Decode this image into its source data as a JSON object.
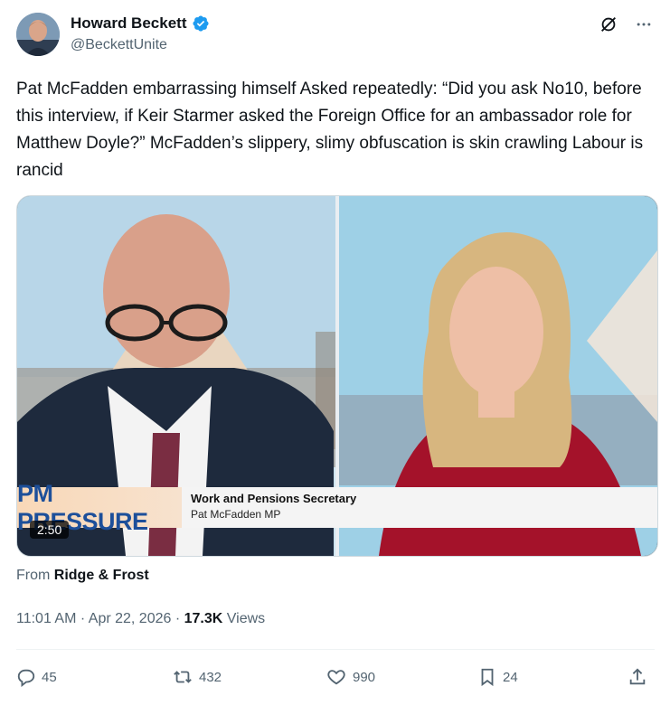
{
  "author": {
    "name": "Howard Beckett",
    "handle": "@BeckettUnite"
  },
  "tweet": {
    "text": "Pat McFadden embarrassing himself Asked repeatedly: “Did you ask No10, before this interview, if Keir Starmer asked the Foreign Office for an ambassador role for Matthew Doyle?” McFadden’s slippery, slimy obfuscation is skin crawling Labour is rancid"
  },
  "video": {
    "lower_third_title": "PM PRESSURE",
    "lower_third_line1": "Work and Pensions Secretary",
    "lower_third_line2": "Pat McFadden MP",
    "duration": "2:50"
  },
  "source": {
    "prefix": "From",
    "name": "Ridge & Frost"
  },
  "meta": {
    "time": "11:01 AM",
    "date": "Apr 22, 2026",
    "views_count": "17.3K",
    "views_label": "Views"
  },
  "actions": {
    "replies": "45",
    "reposts": "432",
    "likes": "990",
    "bookmarks": "24"
  },
  "colors": {
    "verified": "#1d9bf0",
    "secondary_text": "#536471",
    "primary_text": "#0f1419"
  },
  "icons": [
    "verified-badge-icon",
    "grok-icon",
    "more-icon",
    "reply-icon",
    "repost-icon",
    "like-icon",
    "bookmark-icon",
    "share-icon"
  ]
}
